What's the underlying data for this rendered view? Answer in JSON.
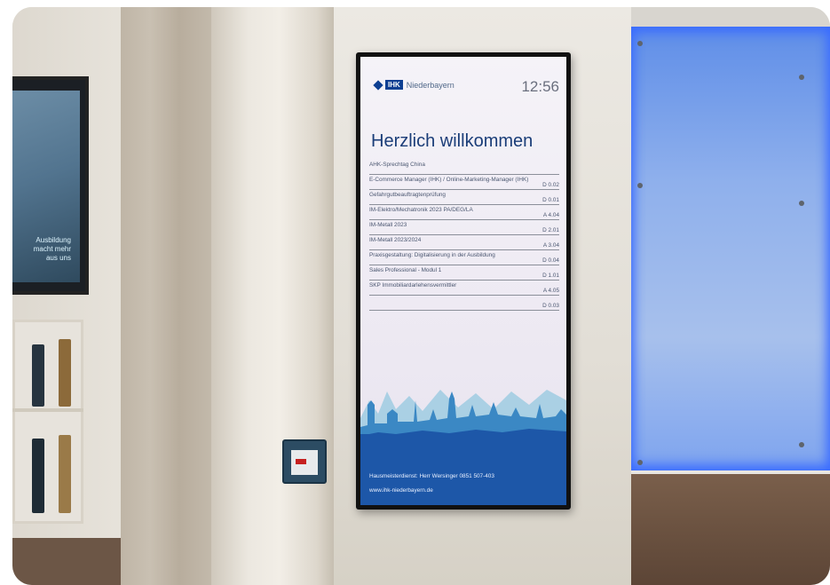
{
  "sign": {
    "logo_badge": "IHK",
    "logo_name": "Niederbayern",
    "time": "12:56",
    "heading": "Herzlich willkommen",
    "rows": [
      {
        "name": "AHK-Sprechtag China",
        "room": ""
      },
      {
        "name": "E-Commerce Manager (IHK) / Online-Marketing-Manager (IHK)",
        "room": "D 0.02"
      },
      {
        "name": "Gefahrgutbeauftragtenprüfung",
        "room": "D 0.01"
      },
      {
        "name": "IM-Elektro/Mechatronik 2023 PA/DEG/LA",
        "room": "A 4.04"
      },
      {
        "name": "IM-Metall 2023",
        "room": "D 2.01"
      },
      {
        "name": "IM-Metall 2023/2024",
        "room": "A 3.04"
      },
      {
        "name": "Praxisgestaltung: Digitalisierung in der Ausbildung",
        "room": "D 0.04"
      },
      {
        "name": "Sales Professional - Modul 1",
        "room": "D 1.01"
      },
      {
        "name": "SKP Immobiliardarlehensvermittler",
        "room": "A 4.05"
      },
      {
        "name": "",
        "room": "D 0.03"
      }
    ],
    "footer_service": "Hausmeisterdienst:  Herr Wersinger 0851 507-403",
    "footer_web": "www.ihk-niederbayern.de"
  },
  "left_tv": {
    "text_lines": [
      "Ausbildung",
      "macht mehr",
      "aus uns"
    ]
  },
  "colors": {
    "sign_blue": "#1d57a8",
    "heading_blue": "#1a3d78",
    "glass_blue": "#7ea4ef"
  }
}
